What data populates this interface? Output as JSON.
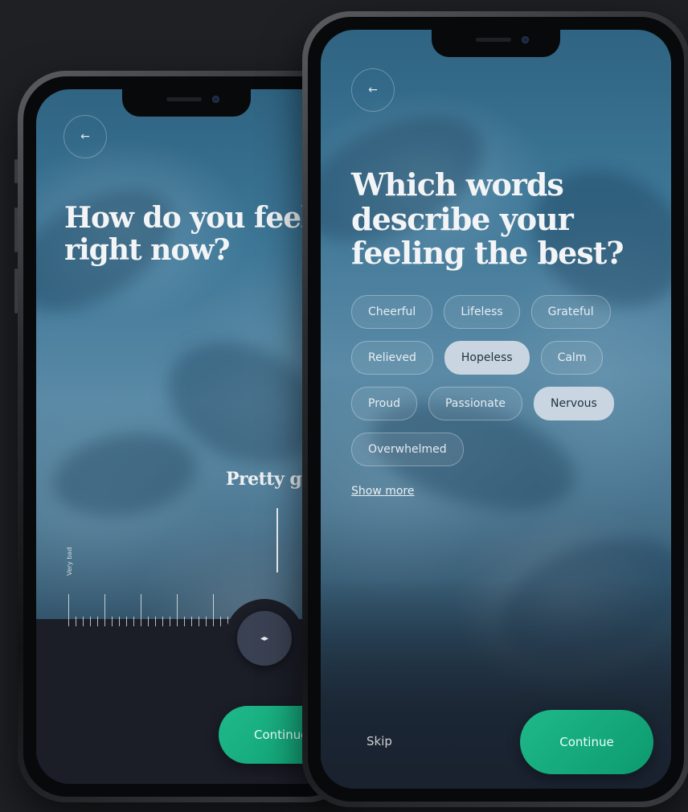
{
  "back_screen": {
    "title_line1": "How do you feel",
    "title_line2": "right now?",
    "mood_label": "Pretty good",
    "scale_min_label": "Very bad",
    "knob_icon": "◂▸",
    "continue_label": "Continue",
    "back_icon": "←"
  },
  "front_screen": {
    "title_line1": "Which words",
    "title_line2": "describe your",
    "title_line3": "feeling the best?",
    "back_icon": "←",
    "chip_rows": [
      [
        {
          "label": "Cheerful",
          "selected": false
        },
        {
          "label": "Lifeless",
          "selected": false
        },
        {
          "label": "Grateful",
          "selected": false
        }
      ],
      [
        {
          "label": "Relieved",
          "selected": false
        },
        {
          "label": "Hopeless",
          "selected": true
        },
        {
          "label": "Calm",
          "selected": false
        }
      ],
      [
        {
          "label": "Proud",
          "selected": false
        },
        {
          "label": "Passionate",
          "selected": false
        },
        {
          "label": "Nervous",
          "selected": true
        }
      ],
      [
        {
          "label": "Overwhelmed",
          "selected": false
        }
      ]
    ],
    "show_more_label": "Show more",
    "skip_label": "Skip",
    "continue_label": "Continue"
  },
  "colors": {
    "accent_green": "#12a97c",
    "chip_selected": "#c9d6e2",
    "page_background": "#1f2024"
  }
}
